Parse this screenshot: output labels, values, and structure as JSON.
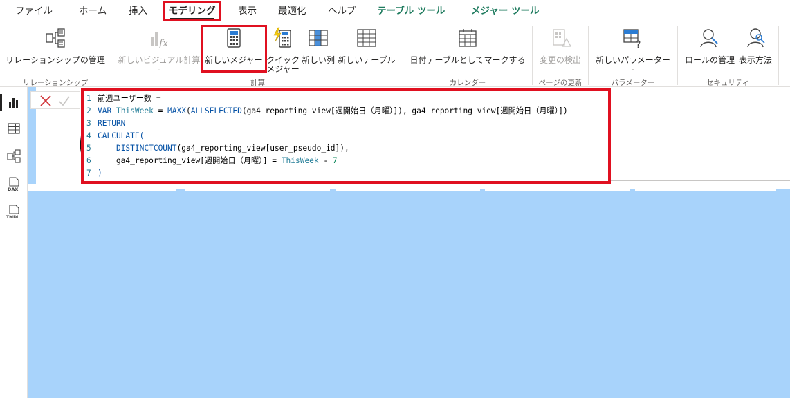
{
  "tabs": [
    {
      "label": "ファイル"
    },
    {
      "label": "ホーム"
    },
    {
      "label": "挿入"
    },
    {
      "label": "モデリング"
    },
    {
      "label": "表示"
    },
    {
      "label": "最適化"
    },
    {
      "label": "ヘルプ"
    },
    {
      "label": "テーブル ツール"
    },
    {
      "label": "メジャー ツール"
    }
  ],
  "ribbon": {
    "manage_relationships": "リレーションシップの管理",
    "new_visual_calc": "新しいビジュアル計算",
    "new_measure": "新しいメジャー",
    "quick_measure_1": "クイック",
    "quick_measure_2": "メジャー",
    "new_column": "新しい列",
    "new_table": "新しいテーブル",
    "mark_date_table": "日付テーブルとしてマークする",
    "detect_changes": "変更の検出",
    "new_parameter": "新しいパラメーター",
    "manage_roles": "ロールの管理",
    "view_as": "表示方法",
    "chev": "⌄",
    "groups": {
      "relationships": "リレーションシップ",
      "calculations": "計算",
      "calendars": "カレンダー",
      "page_refresh": "ページの更新",
      "parameters": "パラメーター",
      "security": "セキュリティ"
    }
  },
  "rail": {
    "dax_label": "DAX",
    "tmdl_label": "TMDL"
  },
  "canvas": {
    "big_glyph": "ほ"
  },
  "formula": {
    "lines": [
      {
        "n": "1",
        "parts": [
          {
            "t": "前週ユーザー数 =",
            "c": "plain"
          }
        ]
      },
      {
        "n": "2",
        "parts": [
          {
            "t": "VAR ",
            "c": "kw"
          },
          {
            "t": "ThisWeek",
            "c": "var"
          },
          {
            "t": " = ",
            "c": "plain"
          },
          {
            "t": "MAXX",
            "c": "kw"
          },
          {
            "t": "(",
            "c": "plain"
          },
          {
            "t": "ALLSELECTED",
            "c": "kw"
          },
          {
            "t": "(ga4_reporting_view[週開始日（月曜）]), ga4_reporting_view[週開始日（月曜）])",
            "c": "plain"
          }
        ]
      },
      {
        "n": "3",
        "parts": [
          {
            "t": "RETURN",
            "c": "kw"
          }
        ]
      },
      {
        "n": "4",
        "parts": [
          {
            "t": "CALCULATE(",
            "c": "kw"
          }
        ]
      },
      {
        "n": "5",
        "parts": [
          {
            "t": "    ",
            "c": "plain"
          },
          {
            "t": "DISTINCTCOUNT",
            "c": "kw"
          },
          {
            "t": "(ga4_reporting_view[user_pseudo_id]),",
            "c": "plain"
          }
        ]
      },
      {
        "n": "6",
        "parts": [
          {
            "t": "    ga4_reporting_view[週開始日（月曜）] = ",
            "c": "plain"
          },
          {
            "t": "ThisWeek",
            "c": "var"
          },
          {
            "t": " - ",
            "c": "plain"
          },
          {
            "t": "7",
            "c": "num"
          }
        ]
      },
      {
        "n": "7",
        "parts": [
          {
            "t": ")",
            "c": "kw"
          }
        ]
      }
    ]
  },
  "colors": {
    "highlight": "#e01020",
    "canvas": "#a8d3fb",
    "context_tab": "#1e7b5e"
  }
}
